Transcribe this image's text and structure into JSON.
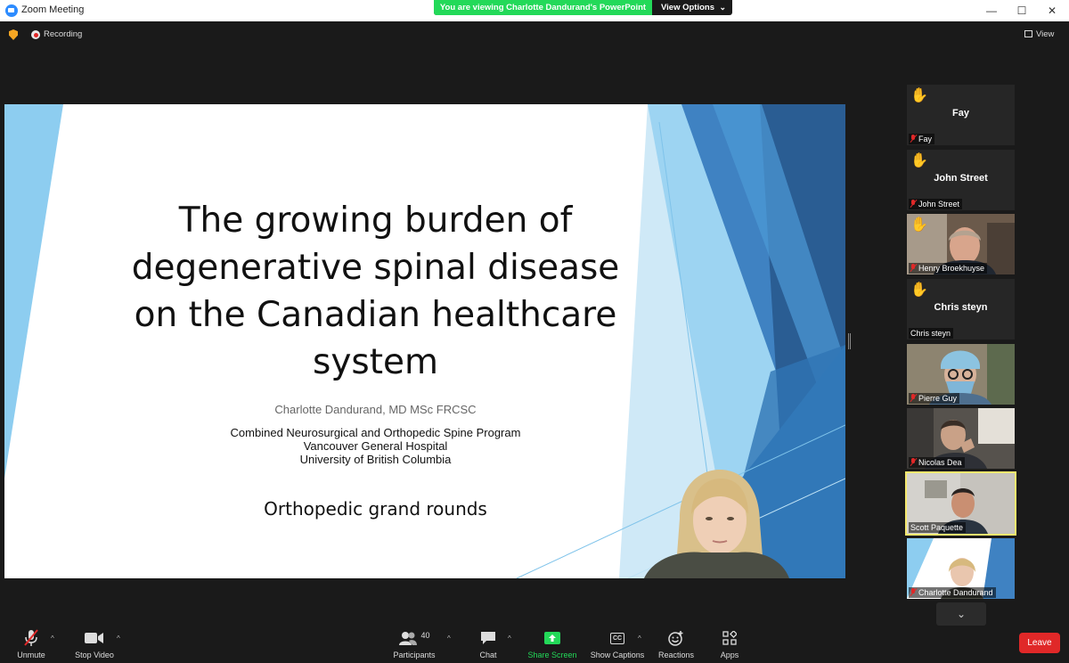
{
  "window": {
    "title": "Zoom Meeting",
    "minimize": "—",
    "maximize": "☐",
    "close": "✕"
  },
  "share_banner": {
    "text": "You are viewing Charlotte Dandurand's PowerPoint",
    "view_options": "View Options",
    "chevron": "⌄"
  },
  "topbar": {
    "recording": "Recording",
    "view": "View"
  },
  "slide": {
    "title_lines": [
      "The growing burden of",
      "degenerative spinal disease",
      "on the Canadian healthcare",
      "system"
    ],
    "author": "Charlotte Dandurand, MD MSc FRCSC",
    "affiliation_lines": [
      "Combined Neurosurgical and Orthopedic Spine Program",
      "Vancouver General Hospital",
      "University of British Columbia"
    ],
    "event": "Orthopedic grand rounds"
  },
  "participants": [
    {
      "name": "Fay",
      "label": "Fay",
      "hand": "✋",
      "muted": true,
      "video": false
    },
    {
      "name": "John Street",
      "label": "John Street",
      "hand": "✋",
      "muted": true,
      "video": false
    },
    {
      "name": "",
      "label": "Henry Broekhuyse",
      "hand": "✋",
      "muted": true,
      "video": true
    },
    {
      "name": "Chris steyn",
      "label": "Chris steyn",
      "hand": "✋",
      "muted": false,
      "video": false
    },
    {
      "name": "",
      "label": "Pierre Guy",
      "hand": "",
      "muted": true,
      "video": true
    },
    {
      "name": "",
      "label": "Nicolas Dea",
      "hand": "",
      "muted": true,
      "video": true
    },
    {
      "name": "",
      "label": "Scott Paquette",
      "hand": "",
      "muted": false,
      "video": true,
      "active": true
    },
    {
      "name": "",
      "label": "Charlotte Dandurand",
      "hand": "",
      "muted": true,
      "video": true
    }
  ],
  "toolbar": {
    "unmute": "Unmute",
    "stop_video": "Stop Video",
    "participants": "Participants",
    "participants_count": "40",
    "chat": "Chat",
    "share_screen": "Share Screen",
    "show_captions": "Show Captions",
    "captions_badge": "CC",
    "reactions": "Reactions",
    "apps": "Apps",
    "leave": "Leave",
    "caret": "^",
    "scroll_down": "⌄"
  },
  "colors": {
    "accent_green": "#23d959",
    "leave_red": "#e02828",
    "slide_blue_dark": "#2a5d93",
    "slide_blue_light": "#8dcdf0",
    "active_speaker": "#f5e86e"
  },
  "icons": [
    "shield-icon",
    "recording-icon",
    "view-grid-icon",
    "hand-raised-icon",
    "mic-off-icon",
    "camera-icon",
    "participants-icon",
    "chat-icon",
    "share-screen-icon",
    "captions-icon",
    "reactions-icon",
    "apps-icon",
    "chevron-down-icon"
  ]
}
